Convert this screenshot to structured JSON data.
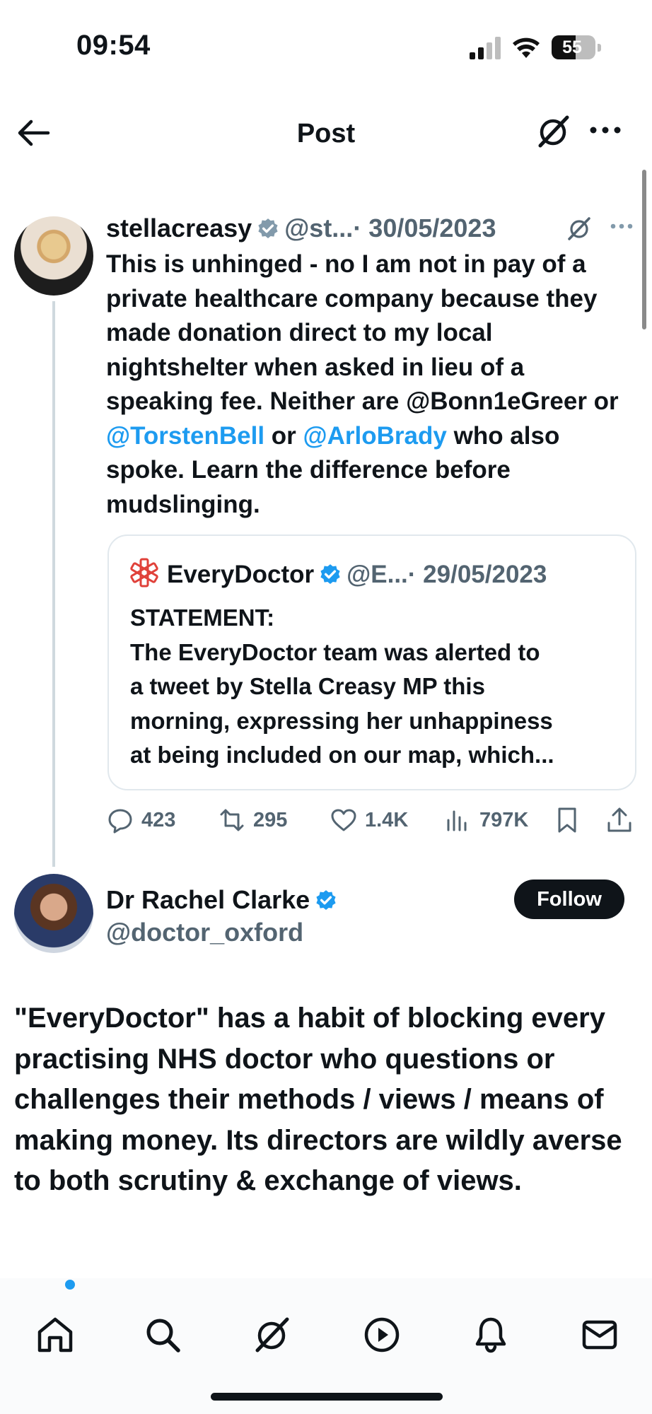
{
  "status_bar": {
    "time": "09:54",
    "battery": "55",
    "battery_level": 0.55
  },
  "header": {
    "title": "Post"
  },
  "tweet": {
    "name": "stellacreasy",
    "handle": "@st...",
    "date": "· 30/05/2023",
    "text": {
      "part1": "This is unhinged - no I am not in pay of a private healthcare company because they made donation direct to my local nightshelter when asked in lieu of a speaking fee. Neither are @Bonn1eGreer or ",
      "mention1": "@TorstenBell",
      "part2": " or ",
      "mention2": "@ArloBrady",
      "part3": " who also spoke. Learn the difference before mudslinging."
    },
    "quote": {
      "name": "EveryDoctor",
      "handle": "@E...",
      "date": "· 29/05/2023",
      "lines": [
        "STATEMENT:",
        "The EveryDoctor team was alerted to",
        "a tweet by Stella Creasy MP this",
        "morning, expressing her unhappiness",
        "at being included on our map, which..."
      ]
    },
    "stats": {
      "replies": "423",
      "reposts": "295",
      "likes": "1.4K",
      "views": "797K"
    }
  },
  "reply": {
    "name": "Dr Rachel Clarke",
    "handle": "@doctor_oxford",
    "follow_label": "Follow",
    "text": "\"EveryDoctor\" has a habit of blocking every practising NHS doctor who questions or challenges their methods / views / means of making money. Its directors are wildly averse to both scrutiny & exchange of views."
  },
  "bottom_nav": {
    "items": [
      "home-icon",
      "search-icon",
      "grok-icon",
      "video-icon",
      "bell-icon",
      "mail-icon"
    ],
    "has_home_notification": true
  },
  "colors": {
    "accent": "#1d9bf0",
    "text": "#0f1419",
    "muted": "#536471",
    "border": "#e1e8ed"
  }
}
